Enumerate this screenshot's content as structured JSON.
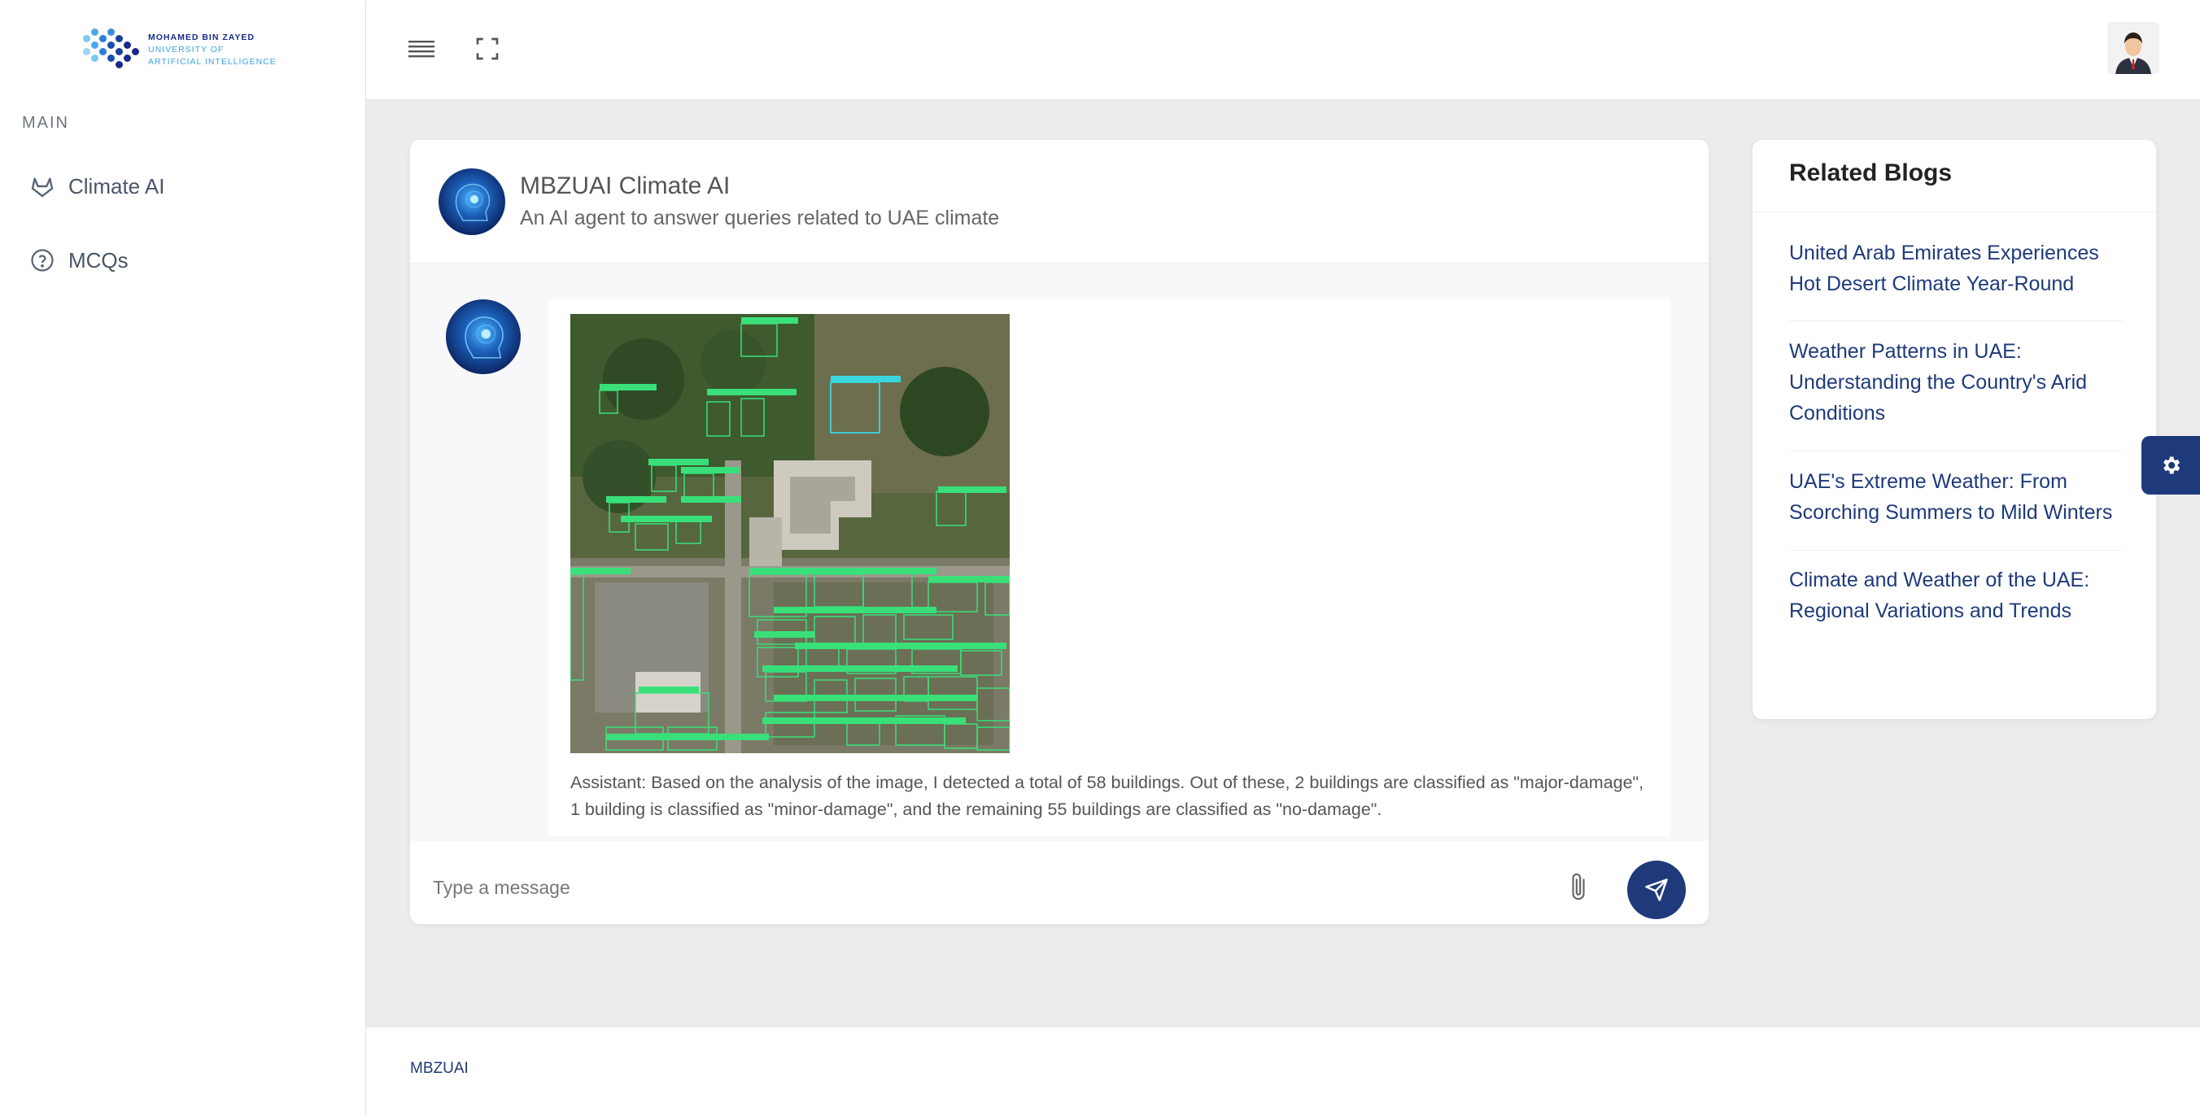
{
  "brand": {
    "line1": "MOHAMED BIN ZAYED",
    "line2": "UNIVERSITY OF",
    "line3": "ARTIFICIAL INTELLIGENCE"
  },
  "sidebar": {
    "section": "MAIN",
    "items": [
      {
        "label": "Climate AI",
        "icon": "gitlab-fox-icon"
      },
      {
        "label": "MCQs",
        "icon": "question-circle-icon"
      }
    ]
  },
  "topbar": {
    "menu_icon": "hamburger-icon",
    "fullscreen_icon": "fullscreen-icon"
  },
  "chat": {
    "title": "MBZUAI Climate AI",
    "subtitle": "An AI agent to answer queries related to UAE climate",
    "message": {
      "text": "Assistant: Based on the analysis of the image, I detected a total of 58 buildings. Out of these, 2 buildings are classified as \"major-damage\", 1 building is classified as \"minor-damage\", and the remaining 55 buildings are classified as \"no-damage\".",
      "image_alt": "satellite image with building damage detections",
      "box_labels": [
        "no-damage",
        "major-damage",
        "minor-damage"
      ]
    },
    "input_placeholder": "Type a message"
  },
  "blogs": {
    "title": "Related Blogs",
    "items": [
      "United Arab Emirates Experiences Hot Desert Climate Year-Round",
      "Weather Patterns in UAE: Understanding the Country's Arid Conditions",
      "UAE's Extreme Weather: From Scorching Summers to Mild Winters",
      "Climate and Weather of the UAE: Regional Variations and Trends"
    ]
  },
  "footer": {
    "text": "MBZUAI"
  },
  "colors": {
    "primary": "#1e3a7b",
    "accent": "#3aa3e0",
    "detect_box": "#39e07a",
    "major_box": "#3ad6e0"
  }
}
